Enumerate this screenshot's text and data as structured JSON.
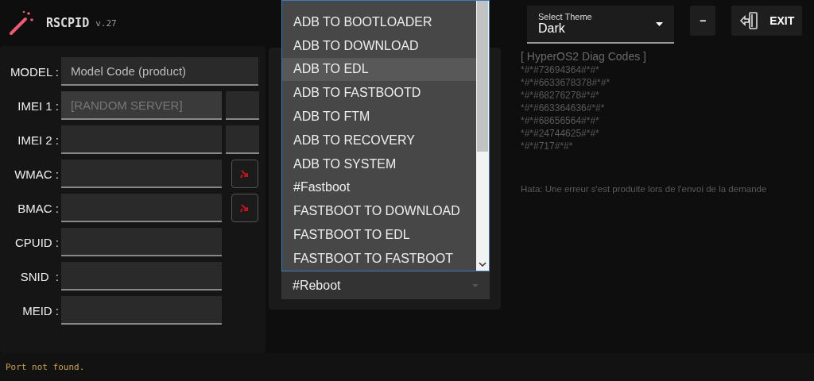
{
  "app": {
    "title": "RSCPID",
    "version": "v.27"
  },
  "fields": [
    {
      "label": "MODEL :",
      "placeholder": "Model Code (product)",
      "kind": "wide",
      "disabled": false
    },
    {
      "label": "IMEI 1 :",
      "placeholder": "[RANDOM SERVER]",
      "kind": "split",
      "disabled": true
    },
    {
      "label": "IMEI 2 :",
      "kind": "split",
      "disabled": false
    },
    {
      "label": "WMAC :",
      "kind": "action",
      "disabled": false
    },
    {
      "label": "BMAC :",
      "kind": "action",
      "disabled": false
    },
    {
      "label": "CPUID :",
      "kind": "plain",
      "disabled": false
    },
    {
      "label": "SNID  :",
      "kind": "plain",
      "disabled": false
    },
    {
      "label": "MEID :",
      "kind": "plain",
      "disabled": false
    }
  ],
  "dropdown": {
    "options": [
      {
        "label": "ADB TO BOOTLOADER",
        "selected": false
      },
      {
        "label": "ADB TO DOWNLOAD",
        "selected": false
      },
      {
        "label": "ADB TO EDL",
        "selected": true
      },
      {
        "label": "ADB TO FASTBOOTD",
        "selected": false
      },
      {
        "label": "ADB TO FTM",
        "selected": false
      },
      {
        "label": "ADB TO RECOVERY",
        "selected": false
      },
      {
        "label": "ADB TO SYSTEM",
        "selected": false
      },
      {
        "label": "#Fastboot",
        "selected": false
      },
      {
        "label": "FASTBOOT TO DOWNLOAD",
        "selected": false
      },
      {
        "label": "FASTBOOT TO EDL",
        "selected": false
      },
      {
        "label": "FASTBOOT TO FASTBOOT",
        "selected": false
      }
    ],
    "value": "#Reboot"
  },
  "theme": {
    "label": "Select Theme",
    "value": "Dark"
  },
  "buttons": {
    "minimize": "−",
    "exit": "EXIT"
  },
  "log": [
    "[ HyperOS2 Diag Codes ]",
    "*#*#73694364#*#*",
    "*#*#6633678378#*#*",
    "*#*#68276278#*#*",
    "*#*#663364636#*#*",
    "*#*#68656564#*#*",
    "*#*#24744625#*#*",
    "*#*#717#*#*"
  ],
  "error": "Hata: Une erreur s'est produite lors de l'envoi de la demande",
  "status": "Port not found."
}
